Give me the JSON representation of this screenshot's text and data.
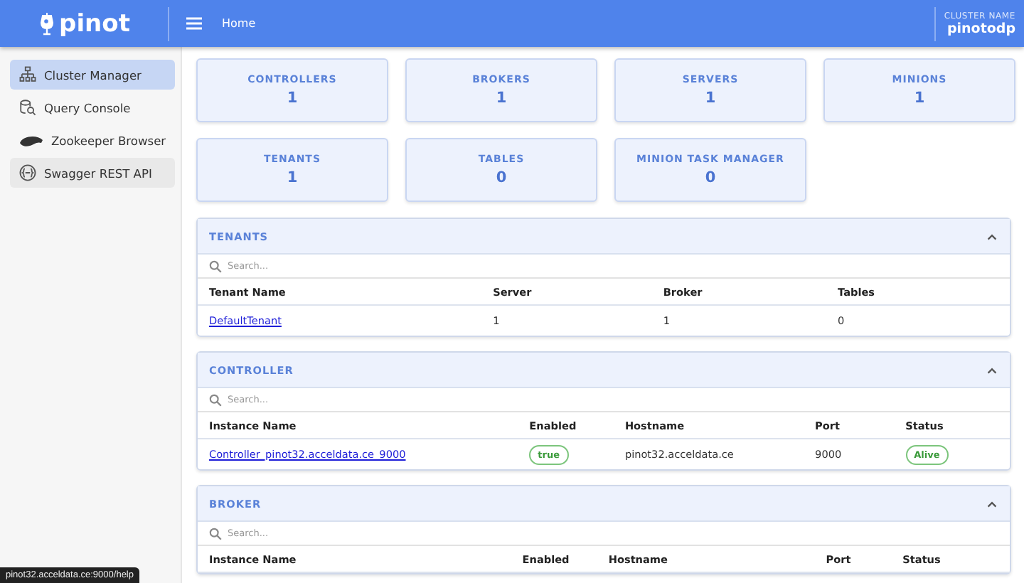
{
  "header": {
    "logo": "pinot",
    "breadcrumb": "Home",
    "cluster_label": "CLUSTER NAME",
    "cluster_name": "pinotodp"
  },
  "sidebar": {
    "items": [
      {
        "label": "Cluster Manager",
        "selected": true,
        "hovered": false
      },
      {
        "label": "Query Console",
        "selected": false,
        "hovered": false
      },
      {
        "label": "Zookeeper Browser",
        "selected": false,
        "hovered": false
      },
      {
        "label": "Swagger REST API",
        "selected": false,
        "hovered": true
      }
    ]
  },
  "stats": [
    {
      "label": "CONTROLLERS",
      "value": "1"
    },
    {
      "label": "BROKERS",
      "value": "1"
    },
    {
      "label": "SERVERS",
      "value": "1"
    },
    {
      "label": "MINIONS",
      "value": "1"
    },
    {
      "label": "TENANTS",
      "value": "1"
    },
    {
      "label": "TABLES",
      "value": "0"
    },
    {
      "label": "MINION TASK MANAGER",
      "value": "0"
    }
  ],
  "sections": [
    {
      "title": "TENANTS",
      "expanded": true,
      "search_placeholder": "Search...",
      "columns": [
        "Tenant Name",
        "Server",
        "Broker",
        "Tables"
      ],
      "rows": [
        [
          {
            "kind": "link",
            "text": "DefaultTenant"
          },
          {
            "kind": "text",
            "text": "1"
          },
          {
            "kind": "text",
            "text": "1"
          },
          {
            "kind": "text",
            "text": "0"
          }
        ]
      ]
    },
    {
      "title": "CONTROLLER",
      "expanded": true,
      "search_placeholder": "Search...",
      "columns": [
        "Instance Name",
        "Enabled",
        "Hostname",
        "Port",
        "Status"
      ],
      "rows": [
        [
          {
            "kind": "link",
            "text": "Controller_pinot32.acceldata.ce_9000"
          },
          {
            "kind": "chip",
            "text": "true"
          },
          {
            "kind": "text",
            "text": "pinot32.acceldata.ce"
          },
          {
            "kind": "text",
            "text": "9000"
          },
          {
            "kind": "chip",
            "text": "Alive"
          }
        ]
      ]
    },
    {
      "title": "BROKER",
      "expanded": true,
      "search_placeholder": "Search...",
      "columns": [
        "Instance Name",
        "Enabled",
        "Hostname",
        "Port",
        "Status"
      ]
    }
  ],
  "status_url": "pinot32.acceldata.ce:9000/help"
}
